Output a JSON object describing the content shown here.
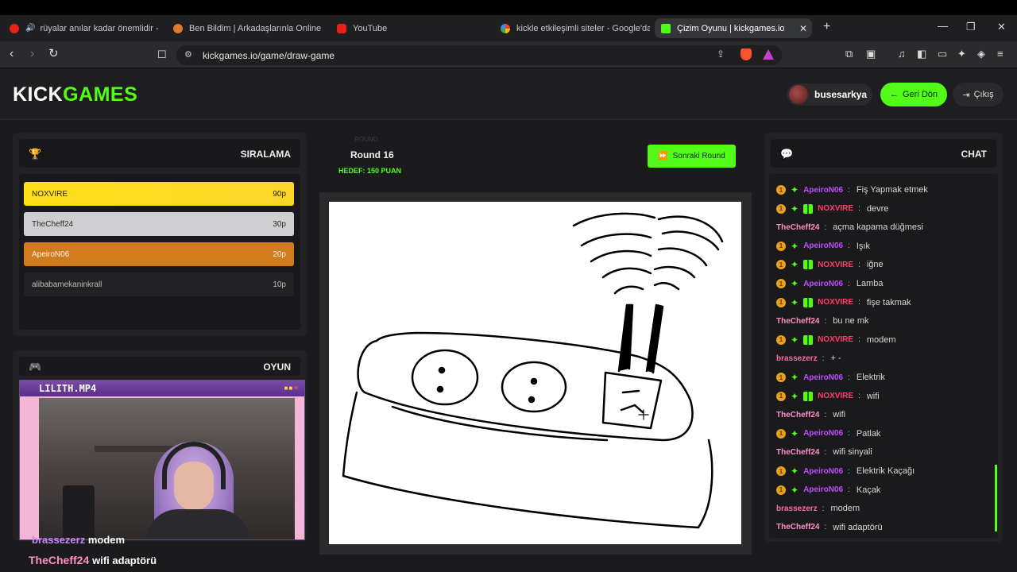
{
  "browser": {
    "tabs": [
      {
        "label": "rüyalar anılar kadar önemlidir - Yo",
        "icon": "youtube-icon"
      },
      {
        "label": "Ben Bildim | Arkadaşlarınla Online Bil",
        "icon": "site-icon"
      },
      {
        "label": "YouTube",
        "icon": "youtube-icon"
      },
      {
        "label": "kickle etkileşimli siteler - Google'da A",
        "icon": "google-icon"
      },
      {
        "label": "Çizim Oyunu | kickgames.io",
        "icon": "kickgames-icon"
      }
    ],
    "url": "kickgames.io/game/draw-game"
  },
  "header": {
    "logo_part1": "KICK",
    "logo_part2": "GAMES",
    "username": "busesarkya",
    "back_label": "Geri Dön",
    "logout_label": "Çıkış"
  },
  "leaderboard": {
    "title": "SIRALAMA",
    "rows": [
      {
        "name": "NOXVIRE",
        "score": "90p"
      },
      {
        "name": "TheCheff24",
        "score": "30p"
      },
      {
        "name": "ApeiroN06",
        "score": "20p"
      },
      {
        "name": "alibabamekaninkrall",
        "score": "10p"
      }
    ]
  },
  "game_panel": {
    "title": "OYUN"
  },
  "round": {
    "ghost_label": "ROUND",
    "label": "Round 16",
    "target": "HEDEF: 150 PUAN",
    "next_button": "Sonraki Round"
  },
  "chat": {
    "title": "CHAT",
    "messages": [
      {
        "user": "ApeiroN06",
        "text": "Fiş Yapmak etmek",
        "badges": "coin,spark"
      },
      {
        "user": "NOXVIRE",
        "text": "devre",
        "badges": "coin,spark,gift"
      },
      {
        "user": "TheCheff24",
        "text": "açma kapama düğmesi",
        "badges": ""
      },
      {
        "user": "ApeiroN06",
        "text": "Işık",
        "badges": "coin,spark"
      },
      {
        "user": "NOXVIRE",
        "text": "iğne",
        "badges": "coin,spark,gift"
      },
      {
        "user": "ApeiroN06",
        "text": "Lamba",
        "badges": "coin,spark"
      },
      {
        "user": "NOXVIRE",
        "text": "fişe takmak",
        "badges": "coin,spark,gift"
      },
      {
        "user": "TheCheff24",
        "text": "bu ne mk",
        "badges": ""
      },
      {
        "user": "NOXVIRE",
        "text": "modem",
        "badges": "coin,spark,gift"
      },
      {
        "user": "brassezerz",
        "text": "+ -",
        "badges": ""
      },
      {
        "user": "ApeiroN06",
        "text": "Elektrik",
        "badges": "coin,spark"
      },
      {
        "user": "NOXVIRE",
        "text": "wifi",
        "badges": "coin,spark,gift"
      },
      {
        "user": "TheCheff24",
        "text": "wifi",
        "badges": ""
      },
      {
        "user": "ApeiroN06",
        "text": "Patlak",
        "badges": "coin,spark"
      },
      {
        "user": "TheCheff24",
        "text": "wifi sinyali",
        "badges": ""
      },
      {
        "user": "ApeiroN06",
        "text": "Elektrik Kaçağı",
        "badges": "coin,spark"
      },
      {
        "user": "ApeiroN06",
        "text": "Kaçak",
        "badges": "coin,spark"
      },
      {
        "user": "brassezerz",
        "text": "modem",
        "badges": ""
      },
      {
        "user": "TheCheff24",
        "text": "wifi adaptörü",
        "badges": ""
      }
    ]
  },
  "webcam": {
    "title": "LILITH.MP4"
  },
  "stream_overlay": {
    "line1_user": "brassezerz",
    "line1_text": "modem",
    "line2_user": "TheCheff24",
    "line2_text": "wifi adaptörü"
  },
  "colors": {
    "accent": "#53fc18",
    "NOXVIRE": "#ff3d6b",
    "ApeiroN06": "#c04cff",
    "TheCheff24": "#ff8fc8",
    "brassezerz": "#ff6aa5"
  }
}
